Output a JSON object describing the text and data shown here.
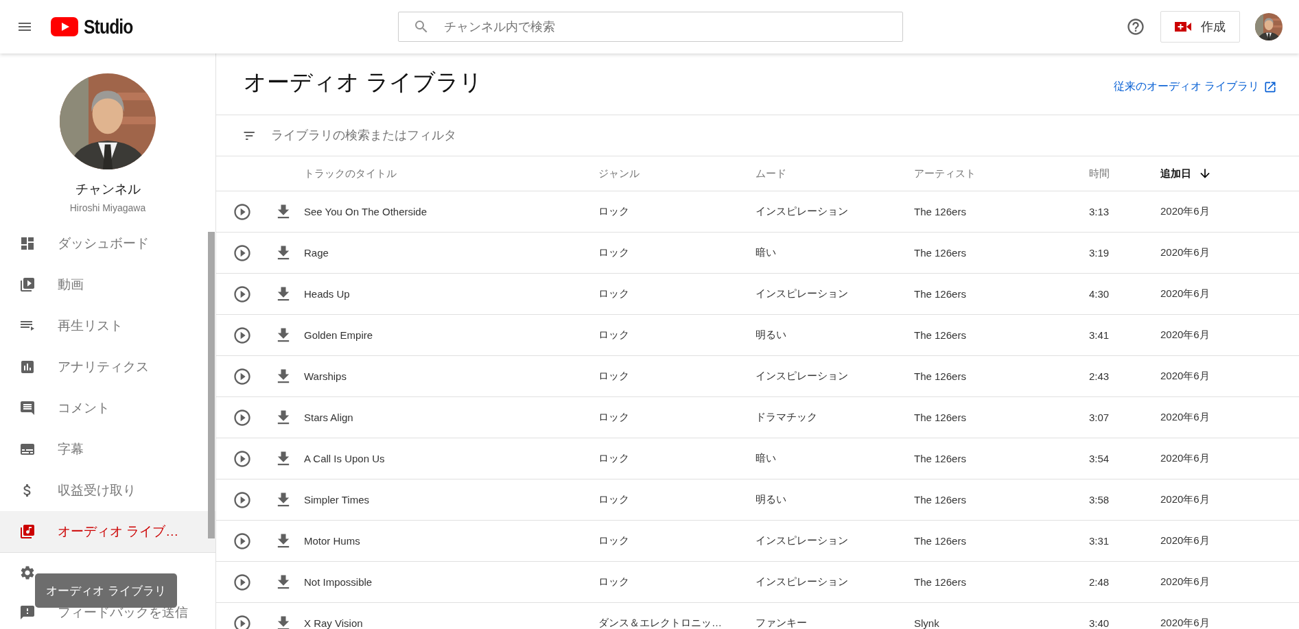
{
  "header": {
    "logo_text": "Studio",
    "search": {
      "placeholder": "チャンネル内で検索"
    },
    "create_button": "作成"
  },
  "channel": {
    "title": "チャンネル",
    "name": "Hiroshi Miyagawa"
  },
  "sidebar": {
    "items": [
      {
        "label": "ダッシュボード",
        "selected": false
      },
      {
        "label": "動画",
        "selected": false
      },
      {
        "label": "再生リスト",
        "selected": false
      },
      {
        "label": "アナリティクス",
        "selected": false
      },
      {
        "label": "コメント",
        "selected": false
      },
      {
        "label": "字幕",
        "selected": false
      },
      {
        "label": "収益受け取り",
        "selected": false
      },
      {
        "label": "オーディオ ライブ…",
        "selected": true
      }
    ],
    "footer_items": [
      {
        "selected": false
      },
      {
        "label": "フィードバックを送信",
        "selected": false
      }
    ],
    "tooltip": "オーディオ ライブラリ"
  },
  "page": {
    "title": "オーディオ ライブラリ",
    "legacy_link": "従来のオーディオ ライブラリ",
    "filter": {
      "placeholder": "ライブラリの検索またはフィルタ"
    }
  },
  "table": {
    "columns": [
      {
        "label": "トラックのタイトル",
        "sorted": false
      },
      {
        "label": "ジャンル",
        "sorted": false
      },
      {
        "label": "ムード",
        "sorted": false
      },
      {
        "label": "アーティスト",
        "sorted": false
      },
      {
        "label": "時間",
        "sorted": false
      },
      {
        "label": "追加日",
        "sorted": true
      }
    ],
    "rows": [
      {
        "title": "See You On The Otherside",
        "genre": "ロック",
        "mood": "インスピレーション",
        "artist": "The 126ers",
        "duration": "3:13",
        "added": "2020年6月"
      },
      {
        "title": "Rage",
        "genre": "ロック",
        "mood": "暗い",
        "artist": "The 126ers",
        "duration": "3:19",
        "added": "2020年6月"
      },
      {
        "title": "Heads Up",
        "genre": "ロック",
        "mood": "インスピレーション",
        "artist": "The 126ers",
        "duration": "4:30",
        "added": "2020年6月"
      },
      {
        "title": "Golden Empire",
        "genre": "ロック",
        "mood": "明るい",
        "artist": "The 126ers",
        "duration": "3:41",
        "added": "2020年6月"
      },
      {
        "title": "Warships",
        "genre": "ロック",
        "mood": "インスピレーション",
        "artist": "The 126ers",
        "duration": "2:43",
        "added": "2020年6月"
      },
      {
        "title": "Stars Align",
        "genre": "ロック",
        "mood": "ドラマチック",
        "artist": "The 126ers",
        "duration": "3:07",
        "added": "2020年6月"
      },
      {
        "title": "A Call Is Upon Us",
        "genre": "ロック",
        "mood": "暗い",
        "artist": "The 126ers",
        "duration": "3:54",
        "added": "2020年6月"
      },
      {
        "title": "Simpler Times",
        "genre": "ロック",
        "mood": "明るい",
        "artist": "The 126ers",
        "duration": "3:58",
        "added": "2020年6月"
      },
      {
        "title": "Motor Hums",
        "genre": "ロック",
        "mood": "インスピレーション",
        "artist": "The 126ers",
        "duration": "3:31",
        "added": "2020年6月"
      },
      {
        "title": "Not Impossible",
        "genre": "ロック",
        "mood": "インスピレーション",
        "artist": "The 126ers",
        "duration": "2:48",
        "added": "2020年6月"
      },
      {
        "title": "X Ray Vision",
        "genre": "ダンス＆エレクトロニッ…",
        "mood": "ファンキー",
        "artist": "Slynk",
        "duration": "3:40",
        "added": "2020年6月"
      }
    ]
  }
}
